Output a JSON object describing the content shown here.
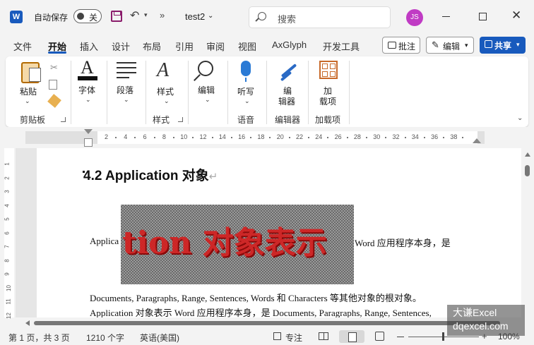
{
  "titlebar": {
    "autosave_label": "自动保存",
    "autosave_state": "关",
    "doc_title": "test2",
    "search_placeholder": "搜索",
    "avatar_initials": "JS",
    "avatar_color": "#c03bc4"
  },
  "tabs": [
    "文件",
    "开始",
    "插入",
    "设计",
    "布局",
    "引用",
    "审阅",
    "视图",
    "AxGlyph",
    "开发工具"
  ],
  "active_tab": "开始",
  "actions": {
    "comment": "批注",
    "edit": "编辑",
    "share": "共享",
    "share_color": "#185abd"
  },
  "ribbon": {
    "paste": "粘贴",
    "font": "字体",
    "paragraph": "段落",
    "styles": "样式",
    "editing": "编辑",
    "dictate": "听写",
    "editor_line1": "编",
    "editor_line2": "辑器",
    "addins_line1": "加",
    "addins_line2": "载项",
    "groups": {
      "clipboard": "剪贴板",
      "styles": "样式",
      "voice": "语音",
      "editor": "编辑器",
      "addins": "加载项"
    }
  },
  "ruler_ticks": [
    "2",
    "4",
    "6",
    "8",
    "10",
    "12",
    "14",
    "16",
    "18",
    "20",
    "22",
    "24",
    "26",
    "28",
    "30",
    "32",
    "34",
    "36",
    "38"
  ],
  "vruler_ticks": [
    "1",
    "2",
    "3",
    "4",
    "5",
    "6",
    "7",
    "8",
    "9",
    "10",
    "11",
    "12"
  ],
  "document": {
    "heading": "4.2 Application  对象",
    "para1_left": "Applica",
    "para1_right": "Word 应用程序本身，是",
    "overlay_text": "tion 对象表示",
    "line2": "Documents, Paragraphs, Range, Sentences, Words 和 Characters 等其他对象的根对象。",
    "line3": "Application 对象表示 Word 应用程序本身，是 Documents, Paragraphs, Range, Sentences,"
  },
  "statusbar": {
    "page": "第 1 页，共 3 页",
    "words": "1210 个字",
    "language": "英语(美国)",
    "focus": "专注",
    "zoom": "100%"
  },
  "watermark": {
    "line1": "大谦Excel",
    "line2": "dqexcel.com"
  }
}
